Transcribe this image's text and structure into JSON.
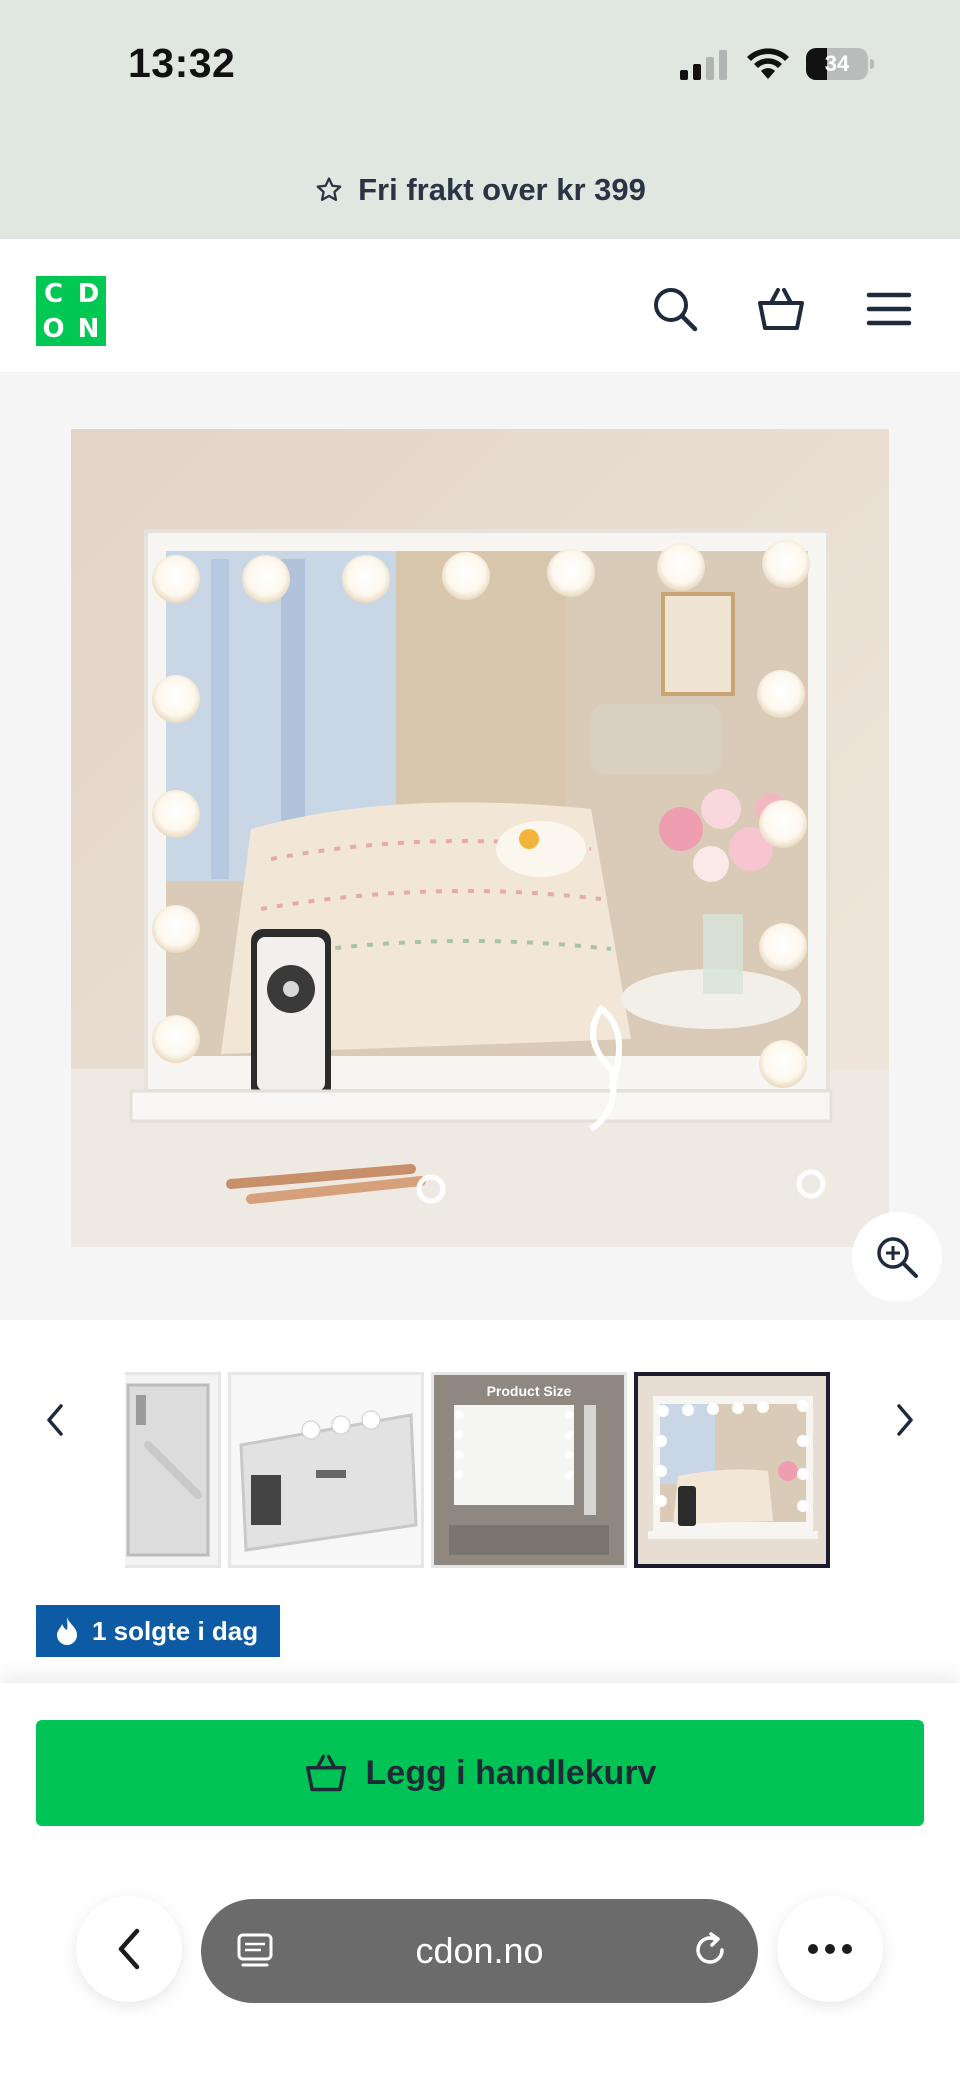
{
  "status_bar": {
    "time": "13:32",
    "battery_percent": "34",
    "battery_level": 0.34
  },
  "promo": {
    "text": "Fri frakt over kr 399",
    "icon": "star-outline-icon"
  },
  "header": {
    "logo_letters": [
      "C",
      "D",
      "O",
      "N"
    ],
    "brand_color": "#00c853",
    "icons": [
      "search-icon",
      "basket-icon",
      "menu-icon"
    ]
  },
  "gallery": {
    "thumbnails": [
      {
        "name": "thumb-mirror-side",
        "caption": ""
      },
      {
        "name": "thumb-mirror-base",
        "caption": ""
      },
      {
        "name": "thumb-product-size",
        "caption": "Product Size"
      },
      {
        "name": "thumb-bedroom",
        "caption": "",
        "active": true
      }
    ]
  },
  "badge": {
    "text": "1 solgte i dag",
    "icon": "flame-icon",
    "color": "#0d5ba5"
  },
  "cart": {
    "button_label": "Legg i handlekurv",
    "button_color": "#00c356",
    "icon": "basket-icon"
  },
  "browser": {
    "url": "cdon.no",
    "back_icon": "chevron-left-icon",
    "reader_icon": "reader-mode-icon",
    "reload_icon": "reload-icon",
    "more_icon": "more-dots-icon"
  }
}
